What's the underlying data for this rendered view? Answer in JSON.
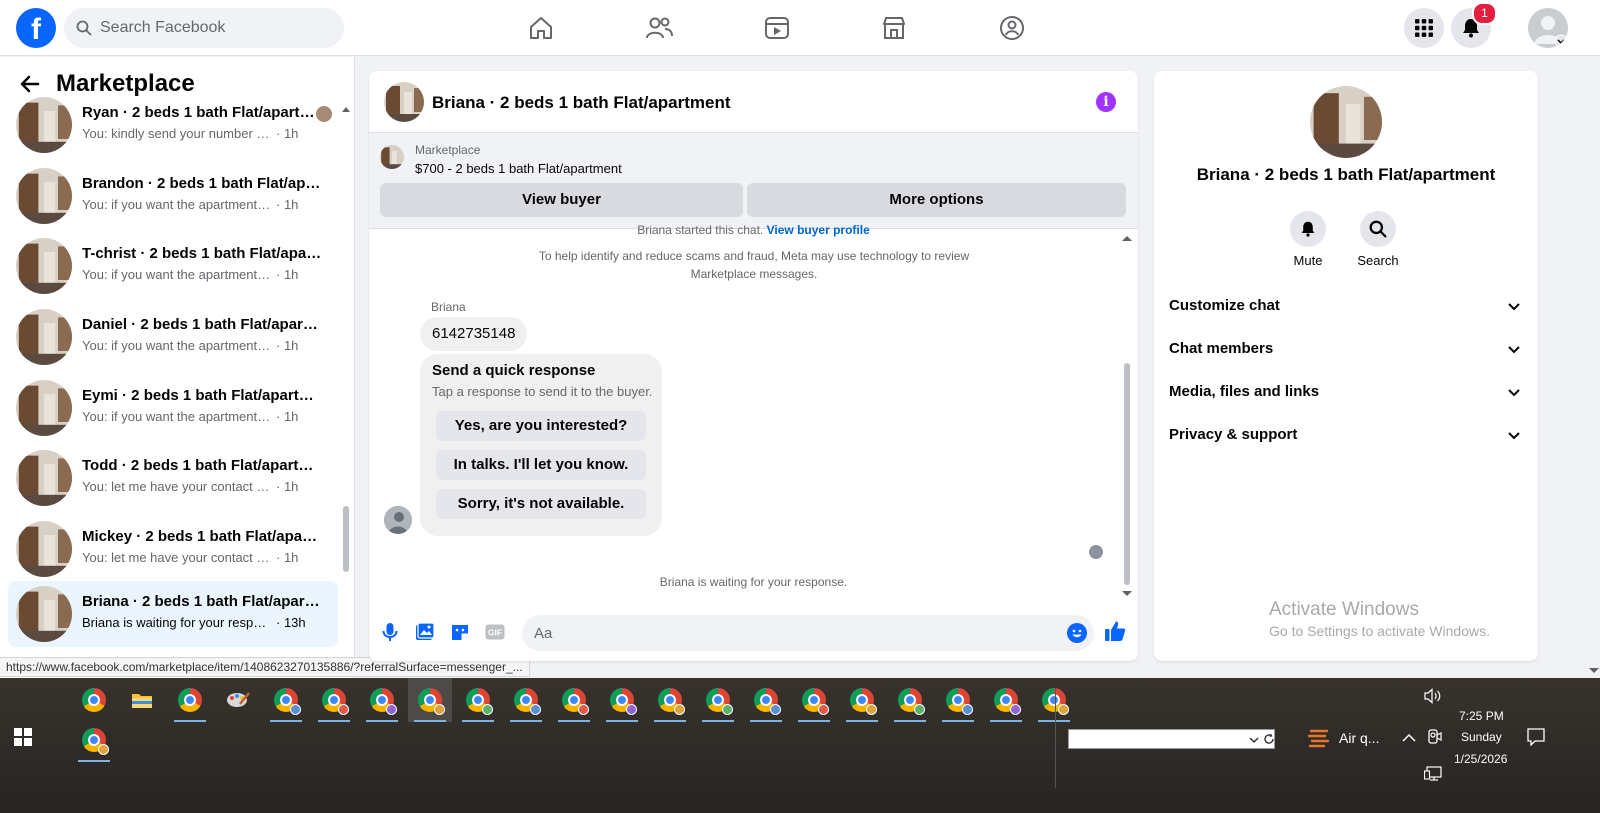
{
  "search": {
    "placeholder": "Search Facebook"
  },
  "notifications": {
    "count": "1"
  },
  "sidebar": {
    "title": "Marketplace",
    "conversations": [
      {
        "name": "Ryan · 2 beds 1 bath Flat/apartment",
        "snippet": "You: kindly send your number i ...",
        "time": "· 1h"
      },
      {
        "name": "Brandon · 2 beds 1 bath Flat/apartment",
        "snippet": "You: if you want the apartment let ...",
        "time": "· 1h"
      },
      {
        "name": "T-christ · 2 beds 1 bath Flat/apartment",
        "snippet": "You: if you want the apartment let ...",
        "time": "· 1h"
      },
      {
        "name": "Daniel · 2 beds 1 bath Flat/apartment",
        "snippet": "You: if you want the apartment let ...",
        "time": "· 1h"
      },
      {
        "name": "Eymi · 2 beds 1 bath Flat/apartment",
        "snippet": "You: if you want the apartment let ...",
        "time": "· 1h"
      },
      {
        "name": "Todd · 2 beds 1 bath Flat/apartment",
        "snippet": "You: let me have your contact num...",
        "time": "· 1h"
      },
      {
        "name": "Mickey · 2 beds 1 bath Flat/apartment",
        "snippet": "You: let me have your contact num...",
        "time": "· 1h"
      },
      {
        "name": "Briana · 2 beds 1 bath Flat/apartment",
        "snippet": "Briana is waiting for your response.",
        "time": "· 13h"
      }
    ]
  },
  "status_url": "https://www.facebook.com/marketplace/item/1408623270135886/?referralSurface=messenger_...",
  "chat": {
    "title": "Briana · 2 beds 1 bath Flat/apartment",
    "marketplace_label": "Marketplace",
    "listing": "$700 - 2 beds 1 bath Flat/apartment",
    "view_buyer": "View buyer",
    "more_options": "More options",
    "started_text": "Briana started this chat.",
    "started_link": "View buyer profile",
    "scam_note": "To help identify and reduce scams and fraud, Meta may use technology to review Marketplace messages.",
    "sender": "Briana",
    "message": "6142735148",
    "quick_title": "Send a quick response",
    "quick_sub": "Tap a response to send it to the buyer.",
    "quick_options": [
      "Yes, are you interested?",
      "In talks. I'll let you know.",
      "Sorry, it's not available."
    ],
    "waiting": "Briana is waiting for your response.",
    "input_placeholder": "Aa"
  },
  "right_panel": {
    "name": "Briana · 2 beds 1 bath Flat/apartment",
    "mute": "Mute",
    "search": "Search",
    "rows": [
      "Customize chat",
      "Chat members",
      "Media, files and links",
      "Privacy & support"
    ],
    "activate_title": "Activate Windows",
    "activate_sub": "Go to Settings to activate Windows."
  },
  "taskbar": {
    "weather": "Air q...",
    "time": "7:25 PM",
    "day": "Sunday",
    "date": "1/25/2026"
  },
  "colors": {
    "brand": "#0866ff",
    "accent_purple": "#a033ff",
    "badge": "#e41e3f"
  }
}
